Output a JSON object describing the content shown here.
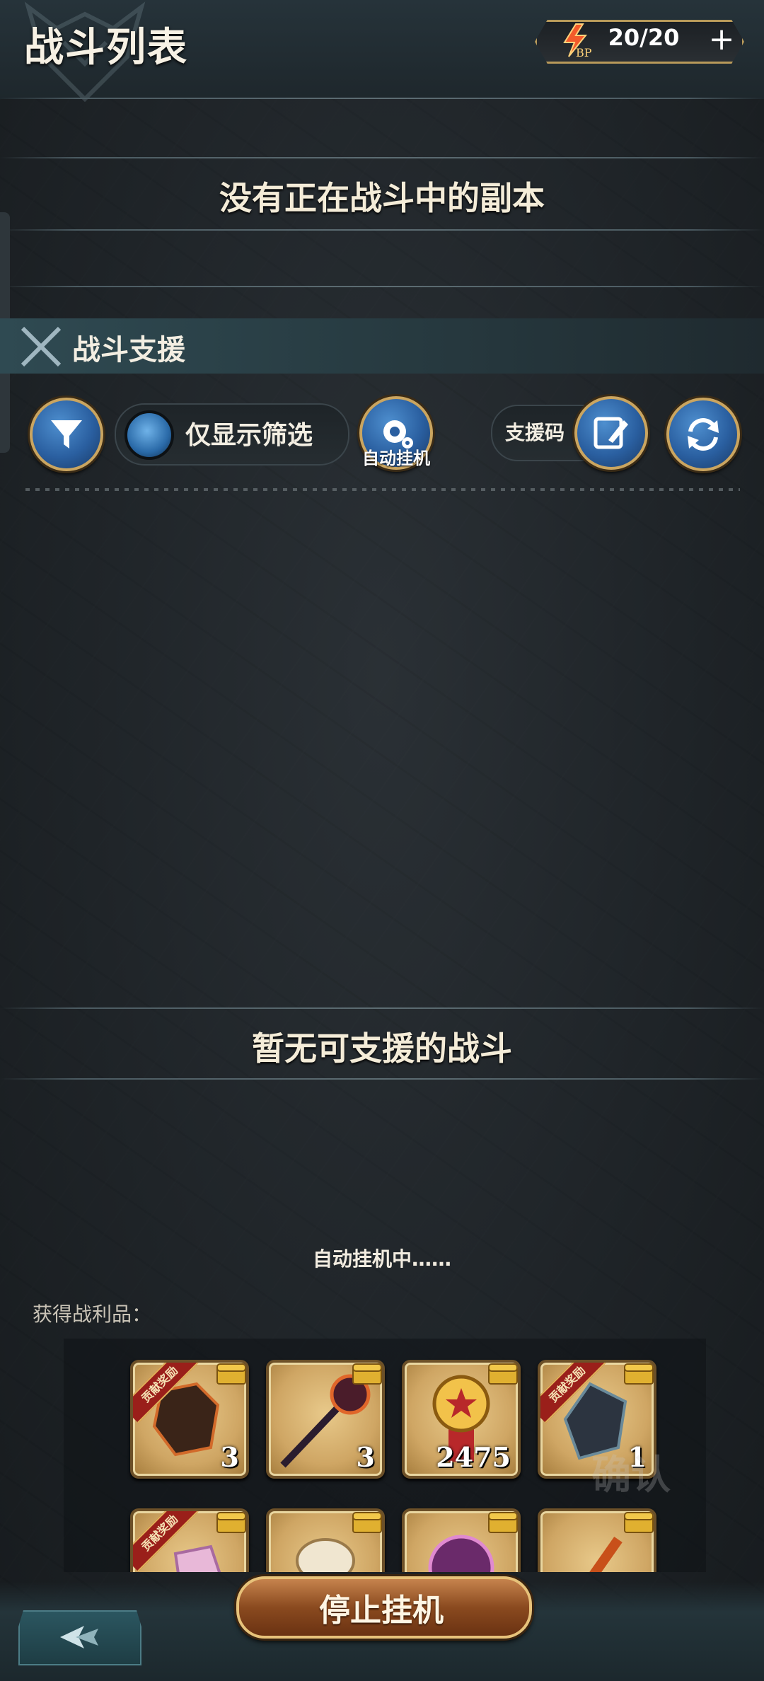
{
  "header": {
    "title": "战斗列表",
    "bp": {
      "icon": "lightning-bp-icon",
      "icon_text": "BP",
      "value": "20/20",
      "add": "+"
    }
  },
  "current_battle": {
    "empty_text": "没有正在战斗中的副本"
  },
  "support": {
    "title": "战斗支援",
    "filter_toggle_label": "仅显示筛选",
    "auto_idle_label": "自动挂机",
    "support_code_label": "支援码",
    "empty_text": "暂无可支援的战斗"
  },
  "auto": {
    "status": "自动挂机中……",
    "loot_label": "获得战利品："
  },
  "loot": [
    {
      "name": "burnt-gauntlet",
      "qty": "3",
      "badge": "贡献奖励"
    },
    {
      "name": "dark-staff",
      "qty": "3",
      "badge": ""
    },
    {
      "name": "gold-medal",
      "qty": "2475",
      "badge": ""
    },
    {
      "name": "dark-crystal",
      "qty": "1",
      "badge": "贡献奖励"
    },
    {
      "name": "pink-crystal",
      "qty": "",
      "badge": "贡献奖励"
    },
    {
      "name": "bone-item",
      "qty": "",
      "badge": ""
    },
    {
      "name": "purple-orb",
      "qty": "",
      "badge": ""
    },
    {
      "name": "fire-wand",
      "qty": "",
      "badge": ""
    }
  ],
  "overlay": {
    "confirm_text": "确认"
  },
  "footer": {
    "stop_label": "停止挂机"
  },
  "colors": {
    "accent_gold": "#caa560",
    "button_blue": "#2a5fa0",
    "stop_button": "#8a4a1f"
  }
}
